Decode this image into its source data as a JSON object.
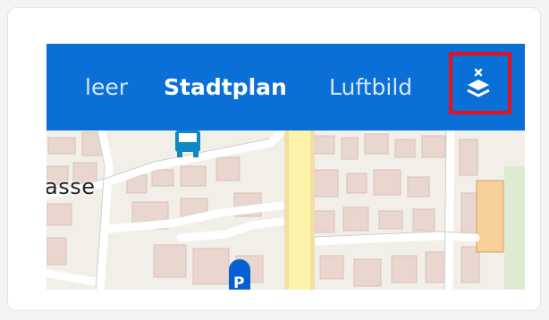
{
  "layer_switcher": {
    "items": [
      {
        "label": "leer",
        "active": false
      },
      {
        "label": "Stadtplan",
        "active": true
      },
      {
        "label": "Luftbild",
        "active": false
      }
    ],
    "close_icon": "layers-close-icon"
  },
  "map": {
    "street_label": "asse",
    "icons": [
      "bus-stop-icon",
      "parking-icon"
    ]
  },
  "colors": {
    "topbar": "#0a6fd6",
    "highlight": "#e8101b",
    "main_road": "#fdf3a9",
    "building": "#e8d6cf",
    "map_background": "#f2efe9"
  }
}
